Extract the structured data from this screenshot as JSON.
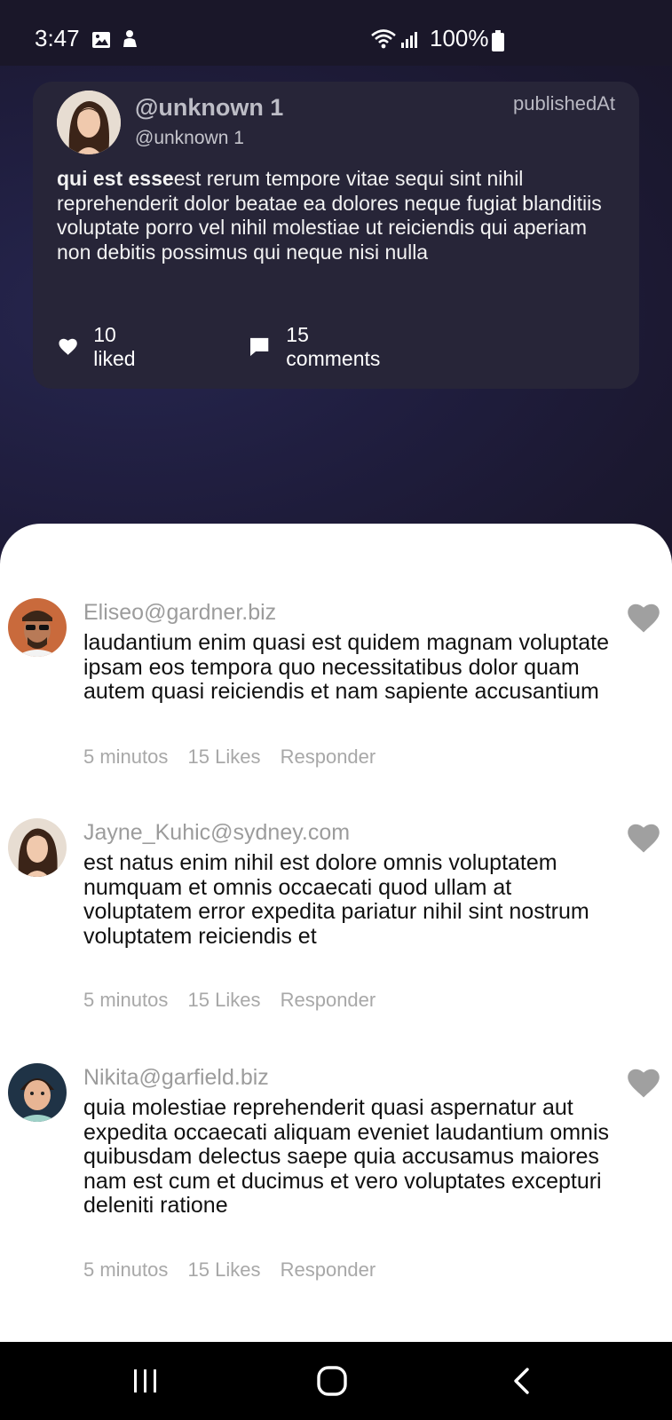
{
  "status_bar": {
    "time": "3:47",
    "battery": "100%",
    "icons": [
      "gallery-icon",
      "notification-icon",
      "wifi-icon",
      "signal-icon",
      "battery-icon"
    ]
  },
  "post": {
    "display_name": "@unknown 1",
    "handle": "@unknown 1",
    "published": "publishedAt",
    "title": "qui est esse",
    "body": "est rerum tempore vitae sequi sint nihil reprehenderit dolor beatae ea dolores neque fugiat blanditiis voluptate porro vel nihil molestiae ut reiciendis qui aperiam non debitis possimus qui neque nisi nulla",
    "likes_label": "10 liked",
    "comments_label": "15 comments"
  },
  "comments": [
    {
      "author": "Eliseo@gardner.biz",
      "text": "laudantium enim quasi est quidem magnam voluptate ipsam eos tempora quo necessitatibus dolor quam autem quasi reiciendis et nam sapiente accusantium",
      "time": "5 minutos",
      "likes": "15 Likes",
      "reply": "Responder"
    },
    {
      "author": "Jayne_Kuhic@sydney.com",
      "text": "est natus enim nihil est dolore omnis voluptatem numquam et omnis occaecati quod ullam at voluptatem error expedita pariatur nihil sint nostrum voluptatem reiciendis et",
      "time": "5 minutos",
      "likes": "15 Likes",
      "reply": "Responder"
    },
    {
      "author": "Nikita@garfield.biz",
      "text": "quia molestiae reprehenderit quasi aspernatur aut expedita occaecati aliquam eveniet laudantium omnis quibusdam delectus saepe quia accusamus maiores nam est cum et ducimus et vero voluptates excepturi deleniti ratione",
      "time": "5 minutos",
      "likes": "15 Likes",
      "reply": "Responder"
    }
  ],
  "colors": {
    "header_background": "#1f1d3d",
    "card_background": "#272538",
    "sheet_background": "#ffffff",
    "muted_text": "#9c9c9c",
    "heart_inactive": "#a0a0a0"
  }
}
